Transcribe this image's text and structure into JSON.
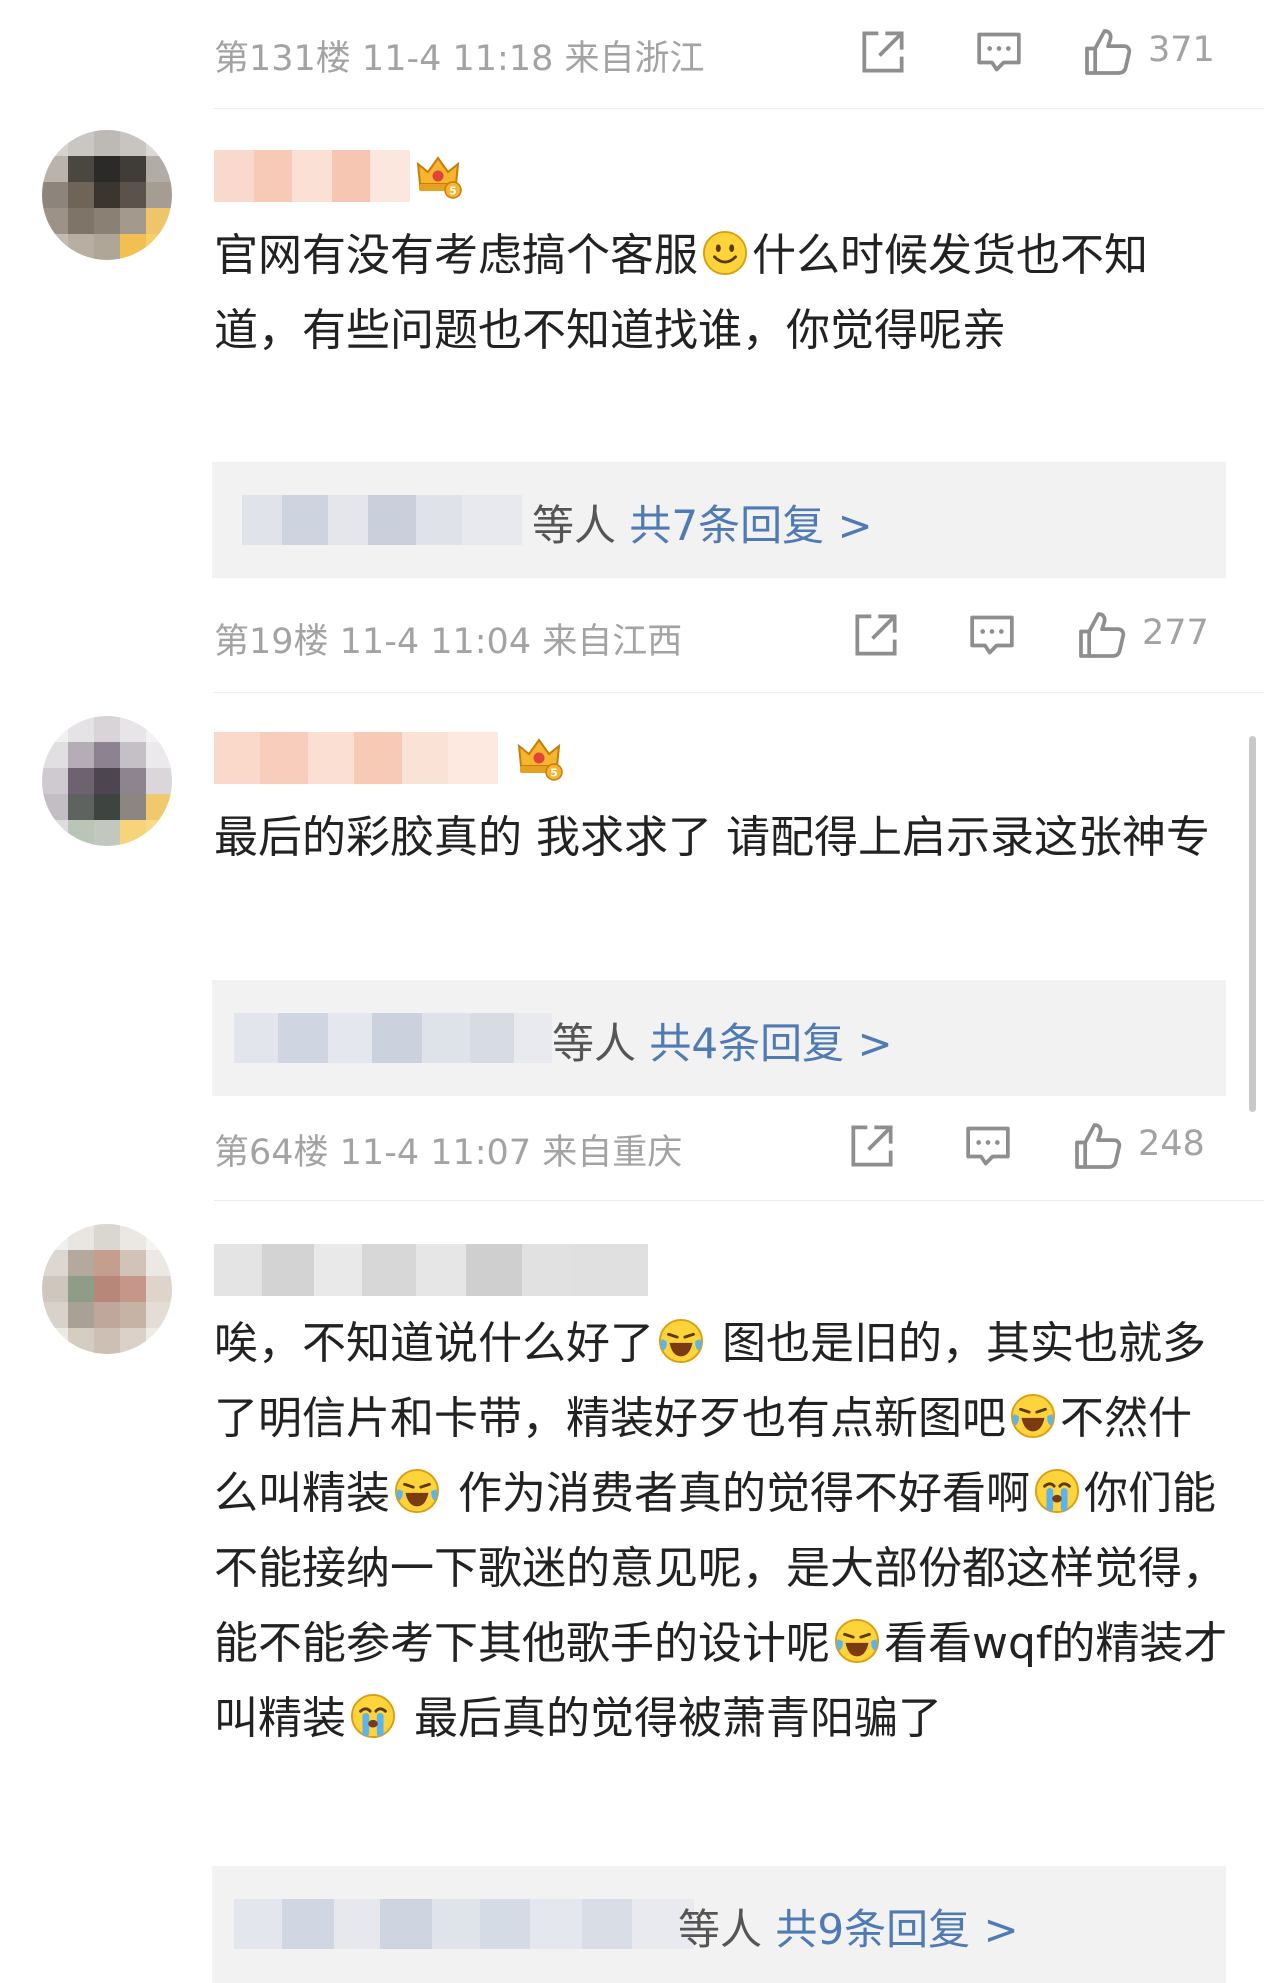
{
  "colors": {
    "meta_text": "#a3a3a3",
    "reply_link": "#4f7ab3",
    "reply_box_bg": "#f2f2f2",
    "comment_text": "#222222"
  },
  "icons": {
    "forward": "forward-icon",
    "comment": "comment-icon",
    "like": "thumbs-up-icon",
    "crown": "crown-badge-icon",
    "emoji_smile": "smile-emoji-icon",
    "emoji_laugh_cry": "laugh-cry-emoji-icon",
    "emoji_cry": "cry-emoji-icon"
  },
  "post0": {
    "meta": "第131楼 11-4 11:18 来自浙江",
    "likes": "371"
  },
  "post1": {
    "comment_part1": "官网有没有考虑搞个客服",
    "comment_part2": "什么时候发货也不知道，有些问题也不知道找谁，你觉得呢亲",
    "reply_etc": "等人",
    "reply_link": "共7条回复 >",
    "meta": "第19楼 11-4 11:04 来自江西",
    "likes": "277"
  },
  "post2": {
    "comment": "最后的彩胶真的 我求求了 请配得上启示录这张神专",
    "reply_etc": "等人",
    "reply_link": "共4条回复 >",
    "meta": "第64楼 11-4 11:07 来自重庆",
    "likes": "248"
  },
  "post3": {
    "seg1": "唉，不知道说什么好了",
    "seg2": "图也是旧的，其实也就多了明信片和卡带，精装好歹也有点新图吧",
    "seg3": "不然什么叫精装",
    "seg4": "作为消费者真的觉得不好看啊",
    "seg5": "你们能不能接纳一下歌迷的意见呢，是大部份都这样觉得，能不能参考下其他歌手的设计呢",
    "seg6": "看看wqf的精装才叫精装",
    "seg7": "最后真的觉得被萧青阳骗了",
    "reply_etc": "等人",
    "reply_link": "共9条回复 >"
  }
}
